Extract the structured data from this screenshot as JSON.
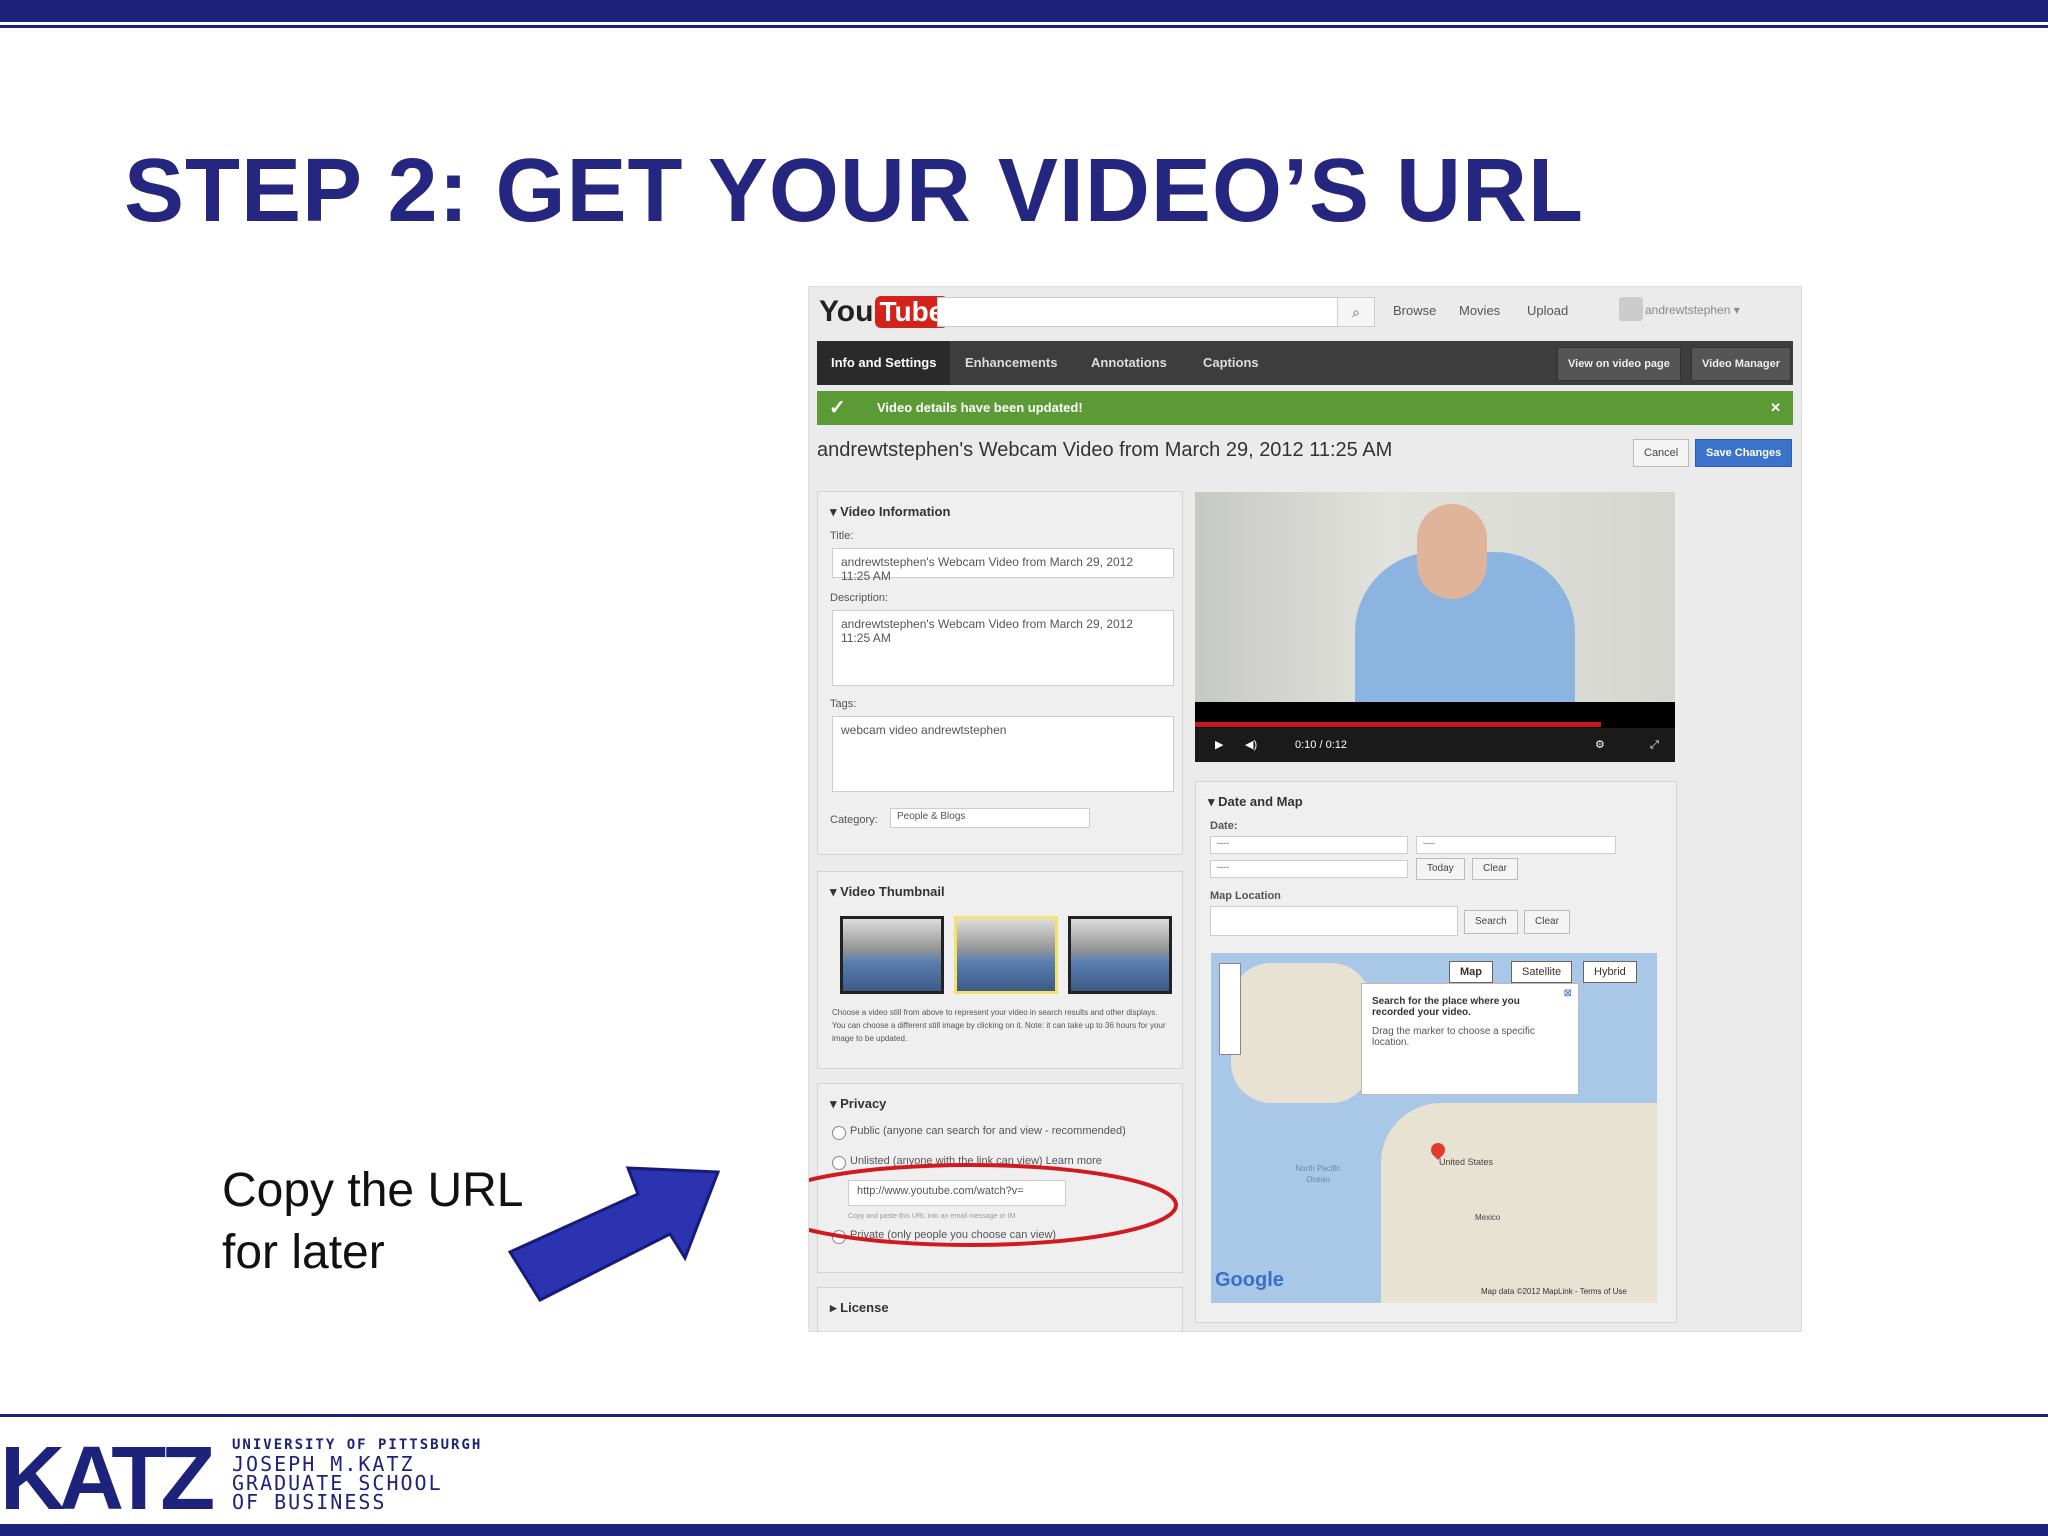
{
  "slide": {
    "title": "STEP 2: GET YOUR VIDEO’S URL",
    "callout_line1": "Copy the URL",
    "callout_line2": "for later",
    "logo_text": "KATZ",
    "school_line1": "UNIVERSITY OF PITTSBURGH",
    "school_line2": "JOSEPH M.KATZ",
    "school_line3": "GRADUATE SCHOOL",
    "school_line4": "OF BUSINESS",
    "colors": {
      "brand": "#1d237a",
      "title": "#25267f",
      "highlight": "#d11a1f"
    }
  },
  "youtube": {
    "logo_you": "You",
    "logo_tube": "Tube",
    "search_icon": "search-icon",
    "nav": [
      "Browse",
      "Movies",
      "Upload"
    ],
    "account": "andrewtstephen ▾",
    "tabs": [
      "Info and Settings",
      "Enhancements",
      "Annotations",
      "Captions"
    ],
    "tab_buttons": [
      "View on video page",
      "Video Manager"
    ],
    "success_message": "Video details have been updated!",
    "close": "✕",
    "video_title": "andrewtstephen's Webcam Video from March 29, 2012 11:25 AM",
    "cancel": "Cancel",
    "save": "Save Changes",
    "info_panel": {
      "heading": "▾ Video Information",
      "title_label": "Title:",
      "title_value": "andrewtstephen's Webcam Video from March 29, 2012 11:25 AM",
      "desc_label": "Description:",
      "desc_value": "andrewtstephen's Webcam Video from March 29, 2012 11:25 AM",
      "tags_label": "Tags:",
      "tags_value": "webcam video andrewtstephen",
      "category_label": "Category:",
      "category_value": "People & Blogs"
    },
    "thumb_panel": {
      "heading": "▾ Video Thumbnail",
      "help1": "Choose a video still from above to represent your video in search results and other displays.",
      "help2": "You can choose a different still image by clicking on it. Note: it can take up to 36 hours for your",
      "help3": "image to be updated."
    },
    "privacy_panel": {
      "heading": "▾ Privacy",
      "public": "Public (anyone can search for and view - recommended)",
      "unlisted": "Unlisted (anyone with the link can view) Learn more",
      "url": "http://www.youtube.com/watch?v=",
      "url_help": "Copy and paste this URL into an email message or IM",
      "private": "Private (only people you choose can view)",
      "license": "▸ License"
    },
    "player": {
      "time": "0:10 / 0:12"
    },
    "date_panel": {
      "heading": "▾ Date and Map",
      "date_label": "Date:",
      "select_blank": "----",
      "today": "Today",
      "clear": "Clear",
      "map_label": "Map Location",
      "search": "Search",
      "map_types": [
        "Map",
        "Satellite",
        "Hybrid"
      ],
      "bubble_bold": "Search for the place where you recorded your video.",
      "bubble_text": "Drag the marker to choose a specific location.",
      "ocean": "North Pacific Ocean",
      "country": "United States",
      "mexico": "Mexico",
      "google": "Google",
      "map_data": "Map data ©2012 MapLink - Terms of Use"
    }
  }
}
